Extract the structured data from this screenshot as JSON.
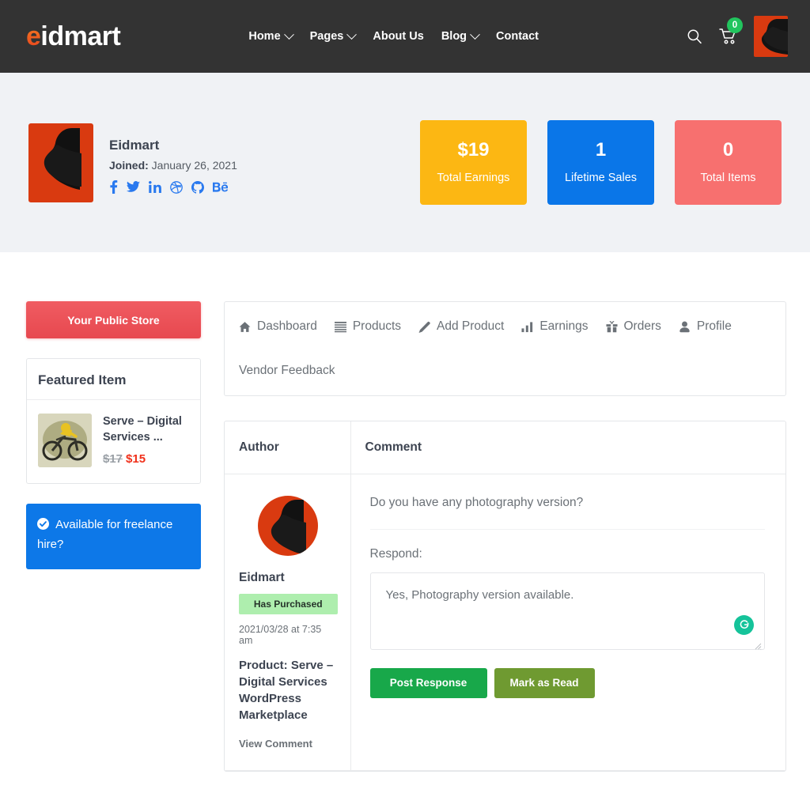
{
  "header": {
    "logo_primary": "e",
    "logo_rest": "idmart",
    "nav": [
      {
        "label": "Home",
        "has_caret": true
      },
      {
        "label": "Pages",
        "has_caret": true
      },
      {
        "label": "About Us",
        "has_caret": false
      },
      {
        "label": "Blog",
        "has_caret": true
      },
      {
        "label": "Contact",
        "has_caret": false
      }
    ],
    "search_icon": "search-icon",
    "cart_icon": "cart-icon",
    "cart_count": "0",
    "avatar_icon": "user-avatar"
  },
  "profile": {
    "name": "Eidmart",
    "joined_label": "Joined:",
    "joined_date": "January 26, 2021",
    "social": [
      {
        "name": "facebook-icon"
      },
      {
        "name": "twitter-icon"
      },
      {
        "name": "linkedin-icon"
      },
      {
        "name": "dribbble-icon"
      },
      {
        "name": "github-icon"
      },
      {
        "name": "behance-icon"
      }
    ],
    "stats": [
      {
        "value": "$19",
        "label": "Total Earnings",
        "color": "#fcb713"
      },
      {
        "value": "1",
        "label": "Lifetime Sales",
        "color": "#0a76e8"
      },
      {
        "value": "0",
        "label": "Total Items",
        "color": "#f7706f"
      }
    ]
  },
  "sidebar": {
    "store_button": "Your Public Store",
    "featured": {
      "title": "Featured Item",
      "item_name": "Serve – Digital Services ...",
      "price_old": "$17",
      "price_new": "$15"
    },
    "freelance": {
      "text": "Available for freelance hire?",
      "icon": "check-circle-icon",
      "color": "#0d78e8"
    }
  },
  "tabs": [
    {
      "label": "Dashboard",
      "icon": "home-icon"
    },
    {
      "label": "Products",
      "icon": "list-icon"
    },
    {
      "label": "Add Product",
      "icon": "pencil-icon"
    },
    {
      "label": "Earnings",
      "icon": "bar-chart-icon"
    },
    {
      "label": "Orders",
      "icon": "gift-icon"
    },
    {
      "label": "Profile",
      "icon": "user-icon"
    },
    {
      "label": "Vendor Feedback",
      "icon": "none"
    }
  ],
  "comments_table": {
    "columns": [
      "Author",
      "Comment"
    ],
    "rows": [
      {
        "author": {
          "avatar": "user-avatar",
          "name": "Eidmart",
          "badge": "Has Purchased",
          "date": "2021/03/28 at 7:35 am",
          "product_label": "Product:",
          "product_name": "Serve – Digital Services WordPress Marketplace",
          "view_link": "View Comment"
        },
        "comment": {
          "text": "Do you have any photography version?",
          "respond_label": "Respond:",
          "respond_value": "Yes, Photography version available.",
          "grammarly_icon": "grammarly-icon",
          "buttons": [
            {
              "label": "Post Response",
              "name": "post-response-button"
            },
            {
              "label": "Mark as Read",
              "name": "mark-as-read-button"
            }
          ]
        }
      }
    ]
  }
}
